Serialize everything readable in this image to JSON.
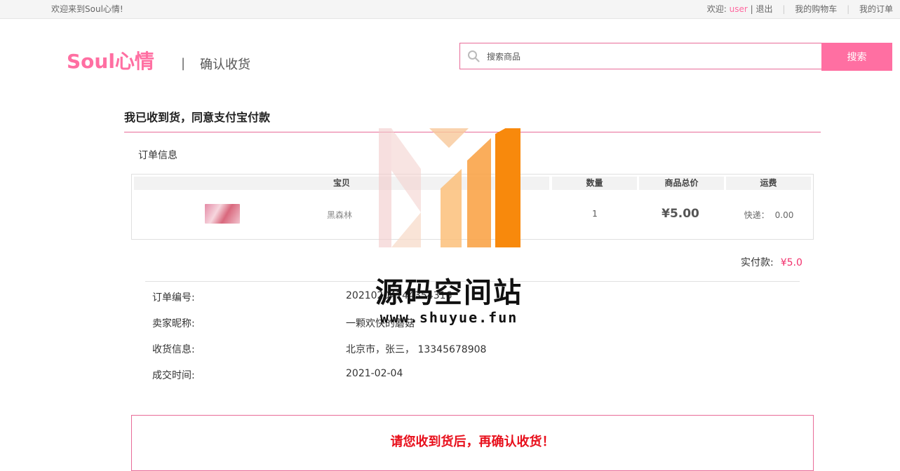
{
  "topbar": {
    "welcome": "欢迎来到Soul心情!",
    "greeting": "欢迎:",
    "username": "user",
    "pipe": "|",
    "logout": "退出",
    "cart": "我的购物车",
    "orders": "我的订单",
    "separator": "|"
  },
  "header": {
    "logo": "Soul心情",
    "separator": "|",
    "page_title": "确认收货"
  },
  "search": {
    "placeholder": "搜索商品",
    "button": "搜索"
  },
  "main": {
    "title": "我已收到货，同意支付宝付款",
    "order_info_label": "订单信息"
  },
  "table": {
    "headers": [
      "宝贝",
      "数量",
      "商品总价",
      "运费"
    ],
    "rows": [
      {
        "name": "黑森林",
        "qty": "1",
        "price": "¥5.00",
        "ship_label": "快递：",
        "ship_amount": "0.00"
      }
    ]
  },
  "payment": {
    "label": "实付款:",
    "amount": "¥5.0"
  },
  "details": [
    {
      "key": "订单编号:",
      "value": "20210204144354316"
    },
    {
      "key": "卖家昵称:",
      "value": "一颗欢快的蘑菇"
    },
    {
      "key": "收货信息:",
      "value": "北京市，张三， 13345678908"
    },
    {
      "key": "成交时间:",
      "value": "2021-02-04"
    }
  ],
  "notice": "请您收到货后，再确认收货！",
  "watermark": {
    "title": "源码空间站",
    "url": "www.shuyue.fun"
  },
  "colors": {
    "accent": "#ff6fa2",
    "price_red": "#f2306c",
    "notice_red": "#e8101c"
  }
}
